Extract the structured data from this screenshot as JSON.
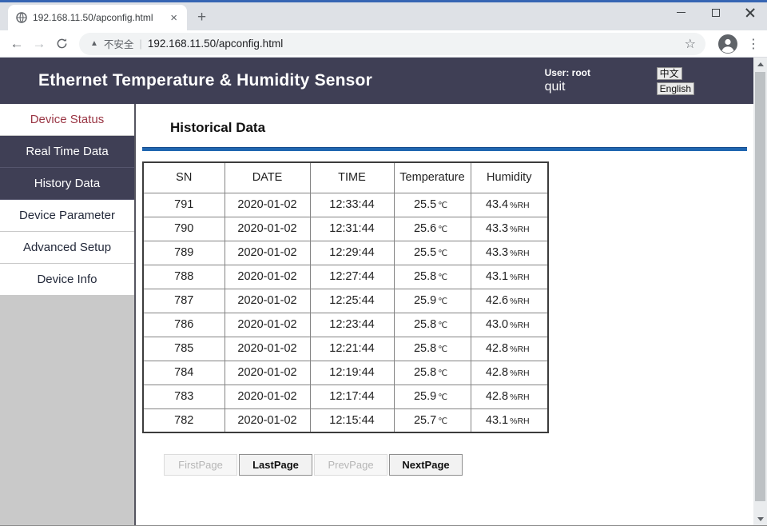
{
  "browser": {
    "tab": {
      "title": "192.168.11.50/apconfig.html"
    },
    "icons": {
      "tab_close": "×",
      "new_tab": "+",
      "back": "←",
      "forward": "→",
      "warning": "▲",
      "star": "☆",
      "menu": "⋮"
    },
    "toolbar": {
      "security_label": "不安全",
      "divider": "|",
      "url": "192.168.11.50/apconfig.html"
    }
  },
  "header": {
    "title": "Ethernet Temperature & Humidity Sensor",
    "user": "User: root",
    "quit": "quit",
    "lang_zh": "中文",
    "lang_en": "English",
    "bg_color": "#3f3f55"
  },
  "sidebar": {
    "items": [
      {
        "label": "Device Status"
      },
      {
        "label": "Real Time Data"
      },
      {
        "label": "History Data"
      },
      {
        "label": "Device Parameter"
      },
      {
        "label": "Advanced Setup"
      },
      {
        "label": "Device Info"
      }
    ]
  },
  "main": {
    "heading": "Historical Data",
    "rule_color": "#2066b0",
    "table": {
      "headers": [
        "SN",
        "DATE",
        "TIME",
        "Temperature",
        "Humidity"
      ],
      "units": {
        "temperature": "℃",
        "humidity": "%RH"
      },
      "rows": [
        {
          "sn": "791",
          "date": "2020-01-02",
          "time": "12:33:44",
          "temperature": "25.5",
          "humidity": "43.4"
        },
        {
          "sn": "790",
          "date": "2020-01-02",
          "time": "12:31:44",
          "temperature": "25.6",
          "humidity": "43.3"
        },
        {
          "sn": "789",
          "date": "2020-01-02",
          "time": "12:29:44",
          "temperature": "25.5",
          "humidity": "43.3"
        },
        {
          "sn": "788",
          "date": "2020-01-02",
          "time": "12:27:44",
          "temperature": "25.8",
          "humidity": "43.1"
        },
        {
          "sn": "787",
          "date": "2020-01-02",
          "time": "12:25:44",
          "temperature": "25.9",
          "humidity": "42.6"
        },
        {
          "sn": "786",
          "date": "2020-01-02",
          "time": "12:23:44",
          "temperature": "25.8",
          "humidity": "43.0"
        },
        {
          "sn": "785",
          "date": "2020-01-02",
          "time": "12:21:44",
          "temperature": "25.8",
          "humidity": "42.8"
        },
        {
          "sn": "784",
          "date": "2020-01-02",
          "time": "12:19:44",
          "temperature": "25.8",
          "humidity": "42.8"
        },
        {
          "sn": "783",
          "date": "2020-01-02",
          "time": "12:17:44",
          "temperature": "25.9",
          "humidity": "42.8"
        },
        {
          "sn": "782",
          "date": "2020-01-02",
          "time": "12:15:44",
          "temperature": "25.7",
          "humidity": "43.1"
        }
      ]
    },
    "pagination": [
      {
        "label": "FirstPage",
        "enabled": false
      },
      {
        "label": "LastPage",
        "enabled": true
      },
      {
        "label": "PrevPage",
        "enabled": false
      },
      {
        "label": "NextPage",
        "enabled": true
      }
    ]
  }
}
